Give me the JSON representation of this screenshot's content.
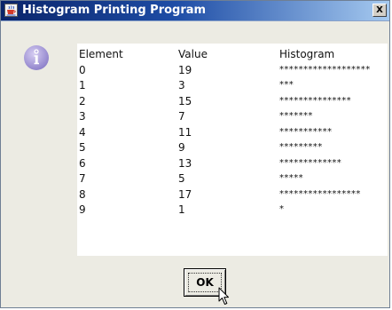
{
  "window": {
    "title": "Histogram Printing Program",
    "icon": "java-cup-icon",
    "close_label": "X"
  },
  "dialog": {
    "icon": "info-icon",
    "table": {
      "headers": [
        "Element",
        "Value",
        "Histogram"
      ],
      "rows": [
        {
          "element": "0",
          "value": "19",
          "histogram": "*******************"
        },
        {
          "element": "1",
          "value": "3",
          "histogram": "***"
        },
        {
          "element": "2",
          "value": "15",
          "histogram": "***************"
        },
        {
          "element": "3",
          "value": "7",
          "histogram": "*******"
        },
        {
          "element": "4",
          "value": "11",
          "histogram": "***********"
        },
        {
          "element": "5",
          "value": "9",
          "histogram": "*********"
        },
        {
          "element": "6",
          "value": "13",
          "histogram": "*************"
        },
        {
          "element": "7",
          "value": "5",
          "histogram": "*****"
        },
        {
          "element": "8",
          "value": "17",
          "histogram": "*****************"
        },
        {
          "element": "9",
          "value": "1",
          "histogram": "*"
        }
      ]
    },
    "ok_label": "OK"
  },
  "colors": {
    "titlebar_start": "#0a246a",
    "titlebar_end": "#a6caf0",
    "dialog_background": "#ecebe3",
    "info_icon_fill": "#9a8fd0"
  }
}
